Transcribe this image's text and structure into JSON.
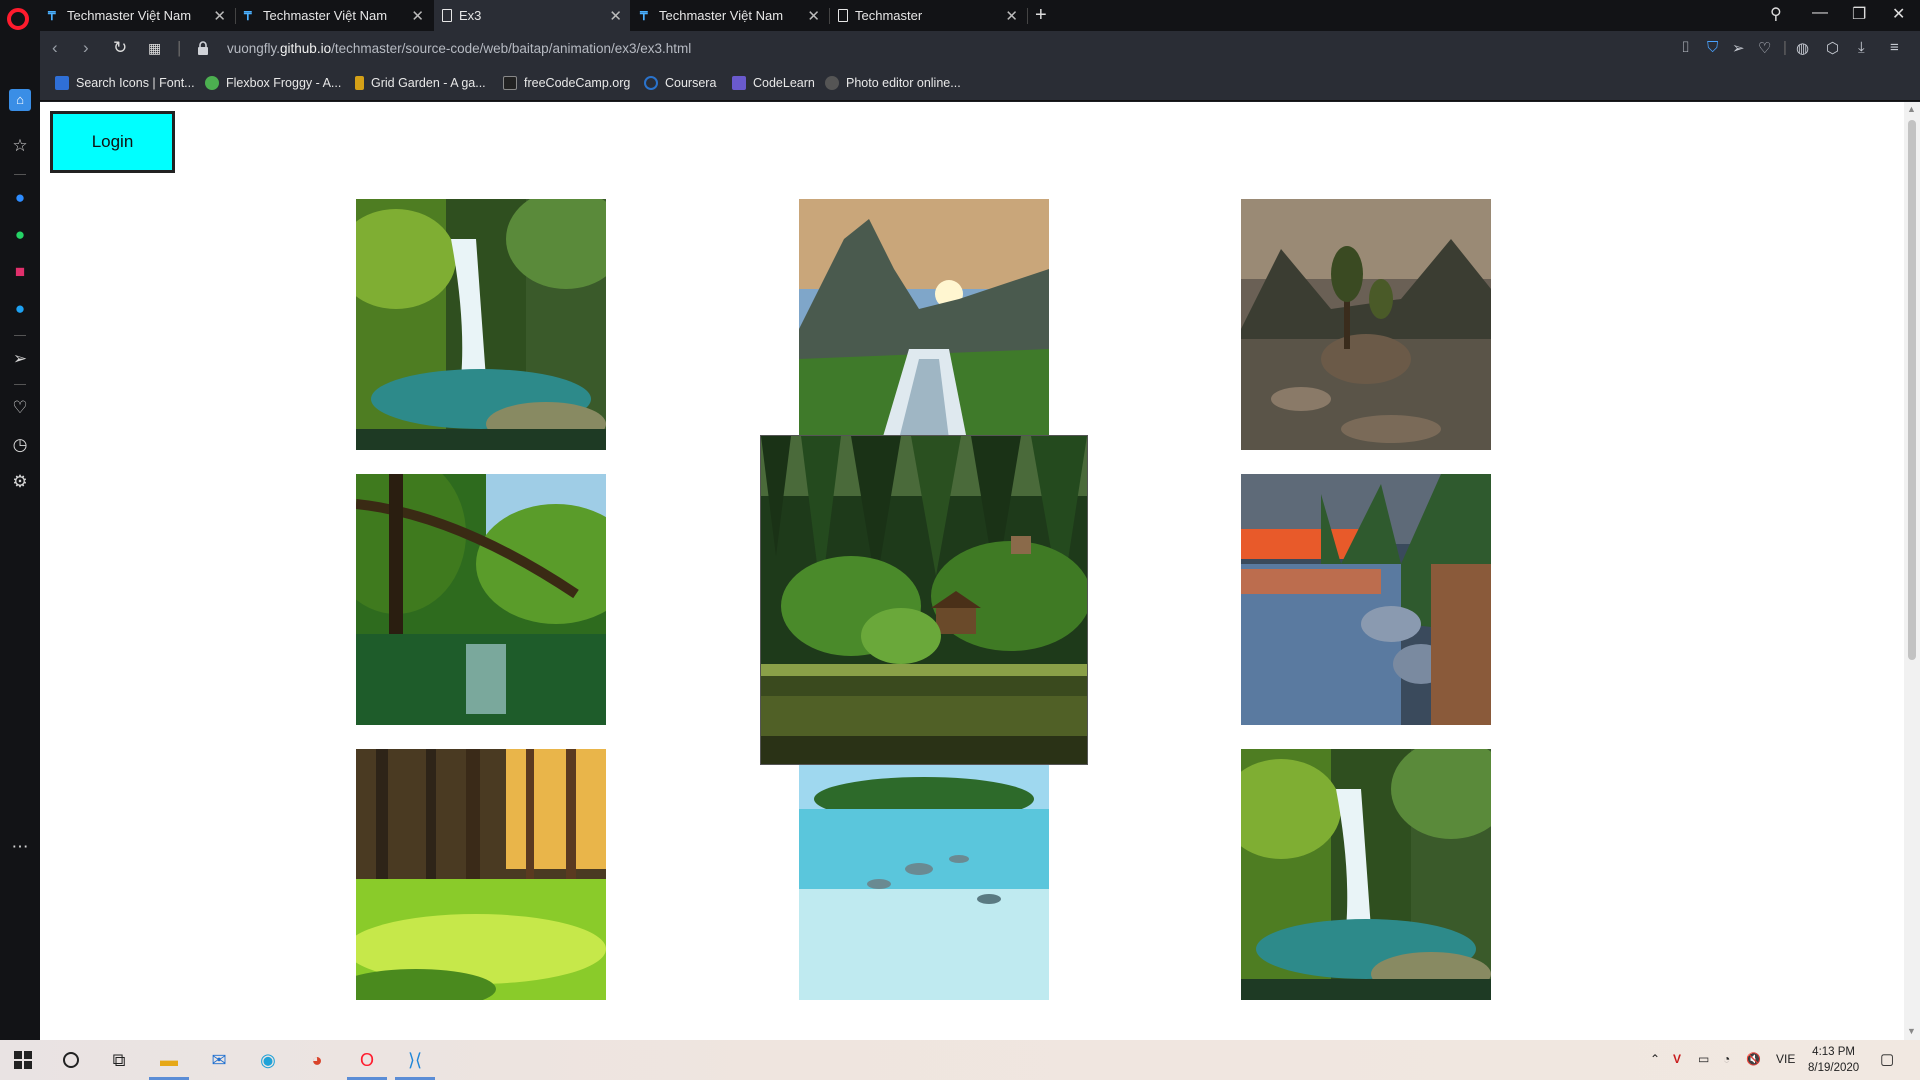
{
  "tabs": [
    {
      "title": "Techmaster Việt Nam",
      "favicon": "techmaster-icon",
      "active": false
    },
    {
      "title": "Techmaster Việt Nam",
      "favicon": "techmaster-icon",
      "active": false
    },
    {
      "title": "Ex3",
      "favicon": "document-icon",
      "active": true
    },
    {
      "title": "Techmaster Việt Nam",
      "favicon": "techmaster-icon",
      "active": false
    },
    {
      "title": "Techmaster",
      "favicon": "document-icon",
      "active": false
    }
  ],
  "address": {
    "url_prefix": "vuongfly.",
    "url_domain": "github.io",
    "url_path": "/techmaster/source-code/web/baitap/animation/ex3/ex3.html"
  },
  "bookmarks": [
    {
      "label": "Search Icons | Font...",
      "color": "#2f6fd6"
    },
    {
      "label": "Flexbox Froggy - A...",
      "color": "#4caf50"
    },
    {
      "label": "Grid Garden - A ga...",
      "color": "#d4a017"
    },
    {
      "label": "freeCodeCamp.org",
      "color": "#222222"
    },
    {
      "label": "Coursera",
      "color": "#2a73cc"
    },
    {
      "label": "CodeLearn",
      "color": "#6a5acd"
    },
    {
      "label": "Photo editor online...",
      "color": "#555555"
    }
  ],
  "page": {
    "login_label": "Login",
    "login_color": "#00ffff",
    "gallery": [
      {
        "name": "waterfall-photo-1",
        "scene": "waterfall"
      },
      {
        "name": "mountain-sunset-waterfall-photo",
        "scene": "sunset-waterfall"
      },
      {
        "name": "lake-island-reflection-photo",
        "scene": "lake-island"
      },
      {
        "name": "green-river-tree-photo",
        "scene": "green-river"
      },
      {
        "name": "forest-cabin-lake-photo-zoomed",
        "scene": "forest-cabin",
        "zoomed": true
      },
      {
        "name": "sunset-lake-rocks-photo",
        "scene": "sunset-lake"
      },
      {
        "name": "sunlit-forest-photo",
        "scene": "sunlit-forest"
      },
      {
        "name": "tropical-island-underwater-photo",
        "scene": "tropical"
      },
      {
        "name": "waterfall-photo-2",
        "scene": "waterfall"
      }
    ]
  },
  "taskbar": {
    "language": "VIE",
    "time": "4:13 PM",
    "date": "8/19/2020"
  }
}
